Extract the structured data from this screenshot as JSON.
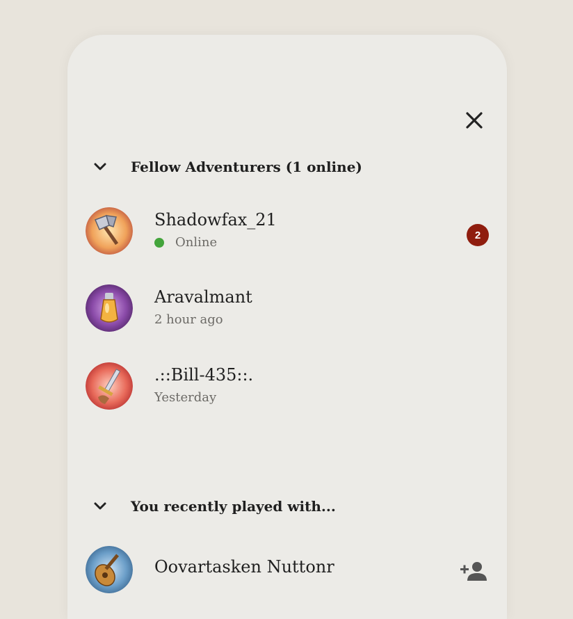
{
  "sections": [
    {
      "title": "Fellow Adventurers (1 online)"
    },
    {
      "title": "You recently played with..."
    }
  ],
  "friends": [
    {
      "name": "Shadowfax_21",
      "status": "Online",
      "badge": "2",
      "online": true
    },
    {
      "name": "Aravalmant",
      "status": "2 hour ago"
    },
    {
      "name": ".::Bill-435::.",
      "status": "Yesterday"
    }
  ],
  "recent": [
    {
      "name": "Oovartasken Nuttonr"
    }
  ],
  "icons": {
    "close": "close-icon",
    "chevron": "chevron-down-icon",
    "add_friend": "person-add-icon"
  },
  "colors": {
    "online": "#43a43b",
    "badge": "#8f1d0e",
    "text": "#1f1f1f",
    "muted": "#6c6a66"
  }
}
